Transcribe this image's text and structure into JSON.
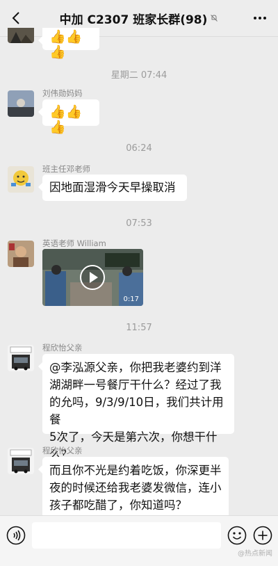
{
  "header": {
    "title": "中加 C2307 班家长群(98)",
    "back_icon": "chevron-left-icon",
    "mute_icon": "bell-muted-icon",
    "more_icon": "ellipsis-icon"
  },
  "messages": [
    {
      "type": "emoji",
      "content": "👍👍👍"
    },
    {
      "type": "time",
      "text": "星期二 07:44"
    },
    {
      "type": "emoji",
      "sender": "刘伟勋妈妈",
      "content": "👍👍👍"
    },
    {
      "type": "time",
      "text": "06:24"
    },
    {
      "type": "text",
      "sender": "班主任邓老师",
      "text": "因地面湿滑今天早操取消"
    },
    {
      "type": "time",
      "text": "07:53"
    },
    {
      "type": "video",
      "sender": "英语老师 William",
      "duration": "0:17"
    },
    {
      "type": "time",
      "text": "11:57"
    },
    {
      "type": "text",
      "sender": "程欣怡父亲",
      "lines": [
        "@李泓源父亲，你把我老婆约到洋",
        "湖湖畔一号餐厅干什么？经过了我",
        "的允吗，9/3/9/10日，我们共计用餐",
        "5次了，今天是第六次，你想干什么？"
      ]
    },
    {
      "type": "text",
      "sender": "程欣怡父亲",
      "lines": [
        "而且你不光是约着吃饭，你深更半",
        "夜的时候还给我老婆发微信，连小",
        "孩子都吃醋了，你知道吗？"
      ]
    }
  ],
  "input_bar": {
    "voice_icon": "voice-icon",
    "emoji_icon": "smile-icon",
    "plus_icon": "plus-circle-icon",
    "watermark": "@热点新闻"
  },
  "colors": {
    "background": "#ececec",
    "bubble": "#ffffff",
    "time_text": "#9b9b9b",
    "sender_text": "#888888",
    "thumb": "#e7b52b"
  }
}
